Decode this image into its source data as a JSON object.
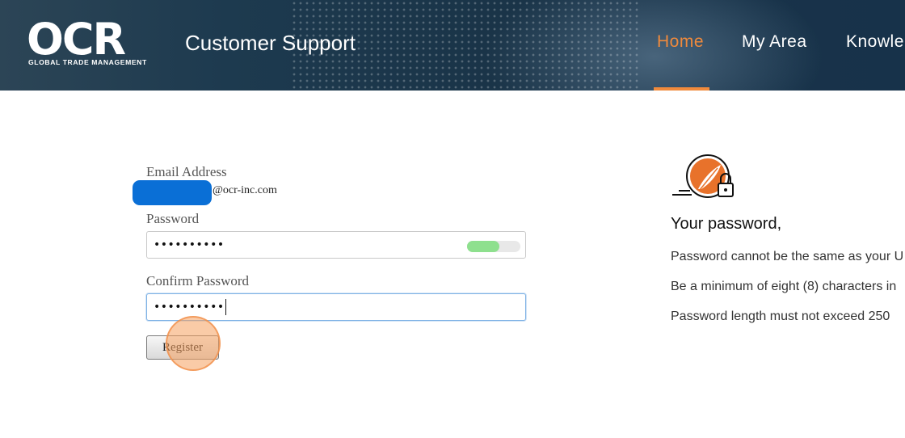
{
  "header": {
    "logo": {
      "mark": "OCR",
      "tagline": "GLOBAL TRADE MANAGEMENT"
    },
    "title": "Customer Support",
    "nav": [
      {
        "label": "Home",
        "active": true
      },
      {
        "label": "My Area",
        "active": false
      },
      {
        "label": "Knowle",
        "active": false
      }
    ],
    "accent_color": "#f08a3c"
  },
  "form": {
    "email_label": "Email Address",
    "email_domain": "@ocr-inc.com",
    "password_label": "Password",
    "password_value": "••••••••••",
    "password_strength": 0.6,
    "confirm_label": "Confirm Password",
    "confirm_value": "••••••••••",
    "register_label": "Register"
  },
  "rules": {
    "icon": "quill-lock-icon",
    "title": "Your password,",
    "items": [
      "Password cannot be the same as your U",
      "Be a minimum of eight (8) characters in",
      "Password length must not exceed 250"
    ]
  }
}
